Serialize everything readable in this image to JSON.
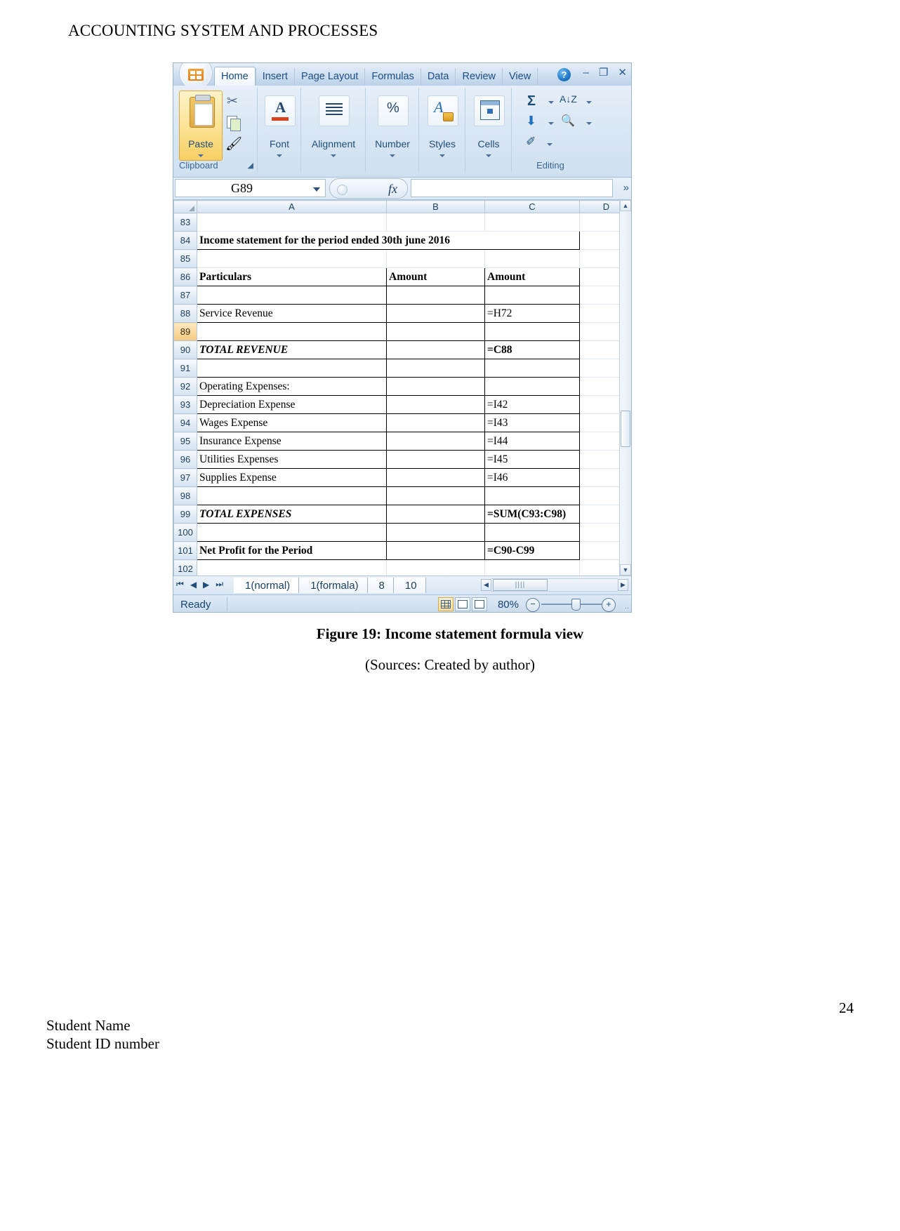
{
  "document": {
    "header": "ACCOUNTING SYSTEM AND PROCESSES",
    "page_number": "24",
    "footer_line1": "Student Name",
    "footer_line2": "Student ID number",
    "figure_caption": "Figure 19: Income statement formula view",
    "figure_source": "(Sources: Created by author)"
  },
  "excel": {
    "ribbon_tabs": [
      {
        "label": "Home",
        "active": true
      },
      {
        "label": "Insert",
        "active": false
      },
      {
        "label": "Page Layout",
        "active": false
      },
      {
        "label": "Formulas",
        "active": false
      },
      {
        "label": "Data",
        "active": false
      },
      {
        "label": "Review",
        "active": false
      },
      {
        "label": "View",
        "active": false
      }
    ],
    "help_label": "?",
    "window_buttons": {
      "minimize": "–",
      "restore": "❐",
      "close": "✕"
    },
    "groups": {
      "clipboard": {
        "label": "Clipboard",
        "dialog_launcher": "⤵",
        "paste_label": "Paste",
        "cut_icon": "✂",
        "copy_icon": "copy-icon",
        "format_painter_icon": "🖌"
      },
      "font": {
        "label": "Font",
        "icon_glyph": "A"
      },
      "alignment": {
        "label": "Alignment",
        "icon_glyph": "≡"
      },
      "number": {
        "label": "Number",
        "icon_glyph": "%"
      },
      "styles": {
        "label": "Styles",
        "icon_glyph": "A"
      },
      "cells": {
        "label": "Cells",
        "icon_glyph": "table-icon"
      },
      "editing": {
        "label": "Editing",
        "autosum": "Σ",
        "fill": "⬇",
        "clear": "✐",
        "sort_filter": "A↓Z",
        "find_select": "🔍"
      }
    },
    "formula_bar": {
      "name_box_value": "G89",
      "formula_value": "",
      "fx_label": "fx",
      "expand_icon": "»"
    },
    "grid": {
      "columns": [
        "A",
        "B",
        "C",
        "D"
      ],
      "selected_cell": "G89",
      "selected_row": "89",
      "rows": [
        {
          "num": "83",
          "a": "",
          "b": "",
          "c": "",
          "style": "plain"
        },
        {
          "num": "84",
          "a": "Income statement for the period ended 30th june 2016",
          "b": "",
          "c": "",
          "style": "title-merged"
        },
        {
          "num": "85",
          "a": "",
          "b": "",
          "c": "",
          "style": "plain"
        },
        {
          "num": "86",
          "a": "Particulars",
          "b": "Amount",
          "c": "Amount",
          "style": "header"
        },
        {
          "num": "87",
          "a": "",
          "b": "",
          "c": "",
          "style": "boxed"
        },
        {
          "num": "88",
          "a": "Service Revenue",
          "b": "",
          "c": "=H72",
          "style": "boxed"
        },
        {
          "num": "89",
          "a": "",
          "b": "",
          "c": "",
          "style": "boxed"
        },
        {
          "num": "90",
          "a": "TOTAL REVENUE",
          "b": "",
          "c": "=C88",
          "style": "total"
        },
        {
          "num": "91",
          "a": "",
          "b": "",
          "c": "",
          "style": "boxed"
        },
        {
          "num": "92",
          "a": "Operating Expenses:",
          "b": "",
          "c": "",
          "style": "boxed"
        },
        {
          "num": "93",
          "a": "Depreciation Expense",
          "b": "",
          "c": "=I42",
          "style": "boxed"
        },
        {
          "num": "94",
          "a": "Wages Expense",
          "b": "",
          "c": "=I43",
          "style": "boxed"
        },
        {
          "num": "95",
          "a": "Insurance Expense",
          "b": "",
          "c": "=I44",
          "style": "boxed"
        },
        {
          "num": "96",
          "a": "Utilities Expenses",
          "b": "",
          "c": "=I45",
          "style": "boxed"
        },
        {
          "num": "97",
          "a": "Supplies Expense",
          "b": "",
          "c": "=I46",
          "style": "boxed"
        },
        {
          "num": "98",
          "a": "",
          "b": "",
          "c": "",
          "style": "boxed"
        },
        {
          "num": "99",
          "a": "TOTAL EXPENSES",
          "b": "",
          "c": "=SUM(C93:C98)",
          "style": "total"
        },
        {
          "num": "100",
          "a": "",
          "b": "",
          "c": "",
          "style": "boxed"
        },
        {
          "num": "101",
          "a": "Net Profit for the Period",
          "b": "",
          "c": "=C90-C99",
          "style": "header"
        },
        {
          "num": "102",
          "a": "",
          "b": "",
          "c": "",
          "style": "plain"
        }
      ]
    },
    "sheet_tabs": [
      {
        "label": "1(normal)",
        "active": true
      },
      {
        "label": "1(formala)",
        "active": false
      },
      {
        "label": "8",
        "active": false
      },
      {
        "label": "10",
        "active": false
      }
    ],
    "status_bar": {
      "state": "Ready",
      "zoom": "80%",
      "zoom_out": "−",
      "zoom_in": "+",
      "view_normal": "normal-view-icon",
      "view_layout": "page-layout-view-icon",
      "view_break": "page-break-view-icon"
    }
  }
}
